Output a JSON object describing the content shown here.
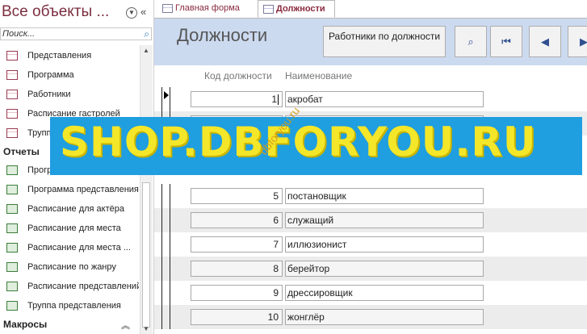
{
  "nav": {
    "title": "Все объекты ...",
    "search_placeholder": "Поиск...",
    "items": [
      {
        "label": "Представления",
        "type": "table"
      },
      {
        "label": "Программа",
        "type": "table"
      },
      {
        "label": "Работники",
        "type": "table"
      },
      {
        "label": "Расписание гастролей",
        "type": "table"
      },
      {
        "label": "Труппа",
        "type": "table"
      }
    ],
    "groups": {
      "reports": "Отчеты",
      "macros": "Макросы"
    },
    "reports": [
      {
        "label": "Программа"
      },
      {
        "label": "Программа представления"
      },
      {
        "label": "Расписание для актёра"
      },
      {
        "label": "Расписание для места"
      },
      {
        "label": "Расписание для места ..."
      },
      {
        "label": "Расписание по жанру"
      },
      {
        "label": "Расписание представлений"
      },
      {
        "label": "Труппа представления"
      }
    ]
  },
  "tabs": [
    {
      "label": "Главная форма",
      "active": false
    },
    {
      "label": "Должности",
      "active": true
    }
  ],
  "form": {
    "title": "Должности",
    "workers_button": "Работники по должности",
    "col_code": "Код должности",
    "col_name": "Наименование",
    "rows": [
      {
        "code": "1",
        "name": "акробат"
      },
      {
        "code": "",
        "name": ""
      },
      {
        "code": "",
        "name": ""
      },
      {
        "code": "5",
        "name": "постановщик"
      },
      {
        "code": "6",
        "name": "служащий"
      },
      {
        "code": "7",
        "name": "иллюзионист"
      },
      {
        "code": "8",
        "name": "берейтор"
      },
      {
        "code": "9",
        "name": "дрессировщик"
      },
      {
        "code": "10",
        "name": "жонглёр"
      }
    ]
  },
  "watermark": {
    "main": "SHOP.DBFORYOU.RU",
    "diag": "dbforyou.ru"
  }
}
